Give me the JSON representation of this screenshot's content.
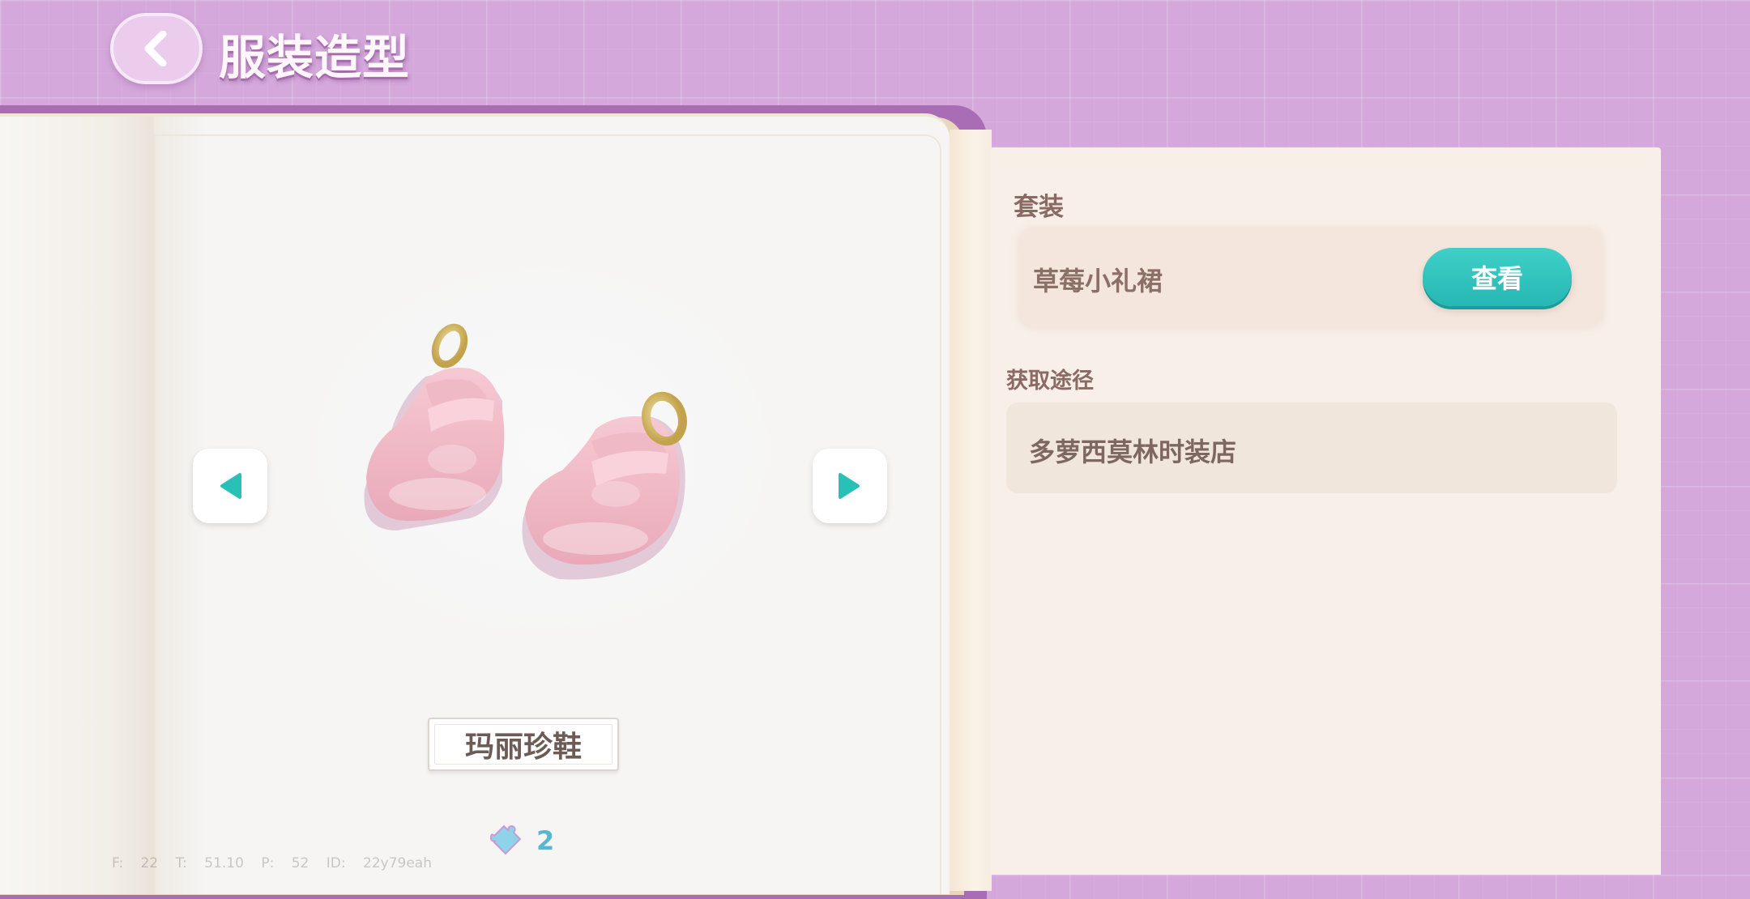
{
  "header": {
    "title": "服装造型",
    "back_icon": "chevron-left-icon"
  },
  "item": {
    "name": "玛丽珍鞋",
    "count": "2",
    "image": "pink-mary-jane-shoes"
  },
  "navigation": {
    "prev_icon": "arrow-left-icon",
    "next_icon": "arrow-right-icon"
  },
  "set": {
    "label": "套装",
    "name": "草莓小礼裙",
    "view_button": "查看"
  },
  "source": {
    "label": "获取途径",
    "value": "多萝西莫林时装店"
  },
  "debug": {
    "text": "F: 22   T: 51.10   P: 52   ID: 22y79eah"
  },
  "colors": {
    "background": "#d4a8db",
    "book_cover": "#a96db5",
    "accent_teal": "#2ec4be",
    "panel": "#f8efe8",
    "text_brown": "#8b6a64"
  }
}
